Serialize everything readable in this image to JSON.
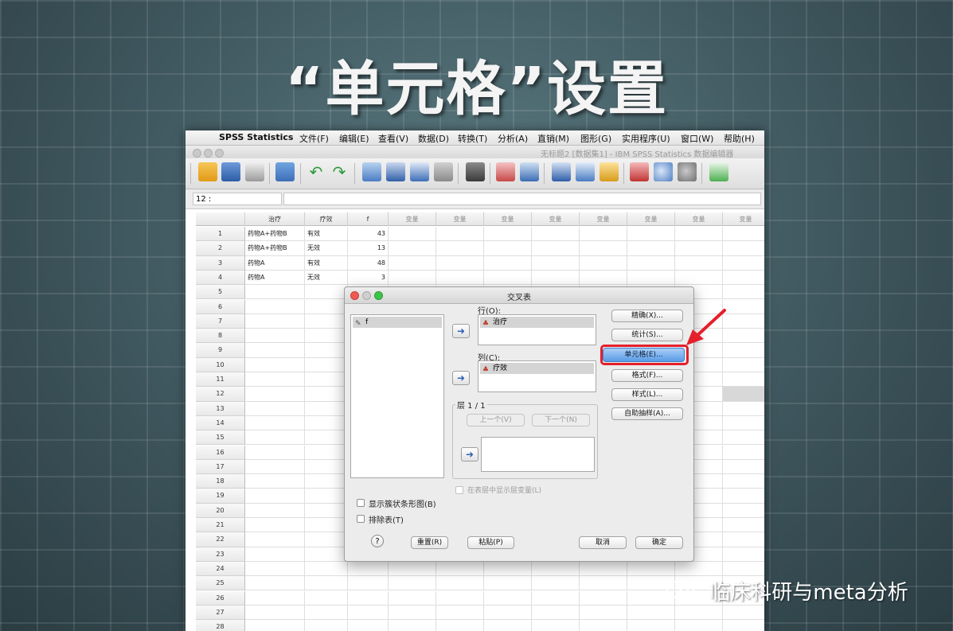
{
  "slide": {
    "title": "“单元格”设置"
  },
  "menubar": {
    "app_name": "SPSS Statistics",
    "items": [
      "文件(F)",
      "编辑(E)",
      "查看(V)",
      "数据(D)",
      "转换(T)",
      "分析(A)",
      "直销(M)",
      "图形(G)",
      "实用程序(U)",
      "窗口(W)",
      "帮助(H)"
    ]
  },
  "window": {
    "title": "无标题2 [数据集1] - IBM SPSS Statistics 数据编辑器"
  },
  "cell_editor": {
    "ref": "12 :",
    "value": ""
  },
  "grid": {
    "columns": [
      "治疗",
      "疗效",
      "f",
      "变量",
      "变量",
      "变量",
      "变量",
      "变量",
      "变量",
      "变量",
      "变量"
    ],
    "rows": [
      [
        "药物A+药物B",
        "有效",
        "43"
      ],
      [
        "药物A+药物B",
        "无效",
        "13"
      ],
      [
        "药物A",
        "有效",
        "48"
      ],
      [
        "药物A",
        "无效",
        "3"
      ]
    ],
    "row_numbers": [
      "1",
      "2",
      "3",
      "4",
      "5",
      "6",
      "7",
      "8",
      "9",
      "10",
      "11",
      "12",
      "13",
      "14",
      "15",
      "16",
      "17",
      "18",
      "19",
      "20",
      "21",
      "22",
      "23",
      "24",
      "25",
      "26",
      "27",
      "28"
    ]
  },
  "dialog": {
    "title": "交叉表",
    "source_vars": [
      "f"
    ],
    "rows_label": "行(O):",
    "rows_vars": [
      "治疗"
    ],
    "cols_label": "列(C):",
    "cols_vars": [
      "疗效"
    ],
    "layer_label": "层 1 / 1",
    "prev_label": "上一个(V)",
    "next_label": "下一个(N)",
    "show_layer_label": "在表层中显示层变量(L)",
    "clustered_bar_label": "显示簇状条形图(B)",
    "suppress_tables_label": "排除表(T)",
    "side_buttons": [
      "精确(X)...",
      "统计(S)...",
      "单元格(E)...",
      "格式(F)...",
      "样式(L)...",
      "自助抽样(A)..."
    ],
    "help_label": "?",
    "reset_label": "重置(R)",
    "paste_label": "粘贴(P)",
    "cancel_label": "取消",
    "ok_label": "确定"
  },
  "watermark": {
    "text": "临床科研与meta分析"
  },
  "colors": {
    "highlight": "#e51f2a",
    "default_button": "#5b9be6",
    "background": "#3f5a62"
  }
}
